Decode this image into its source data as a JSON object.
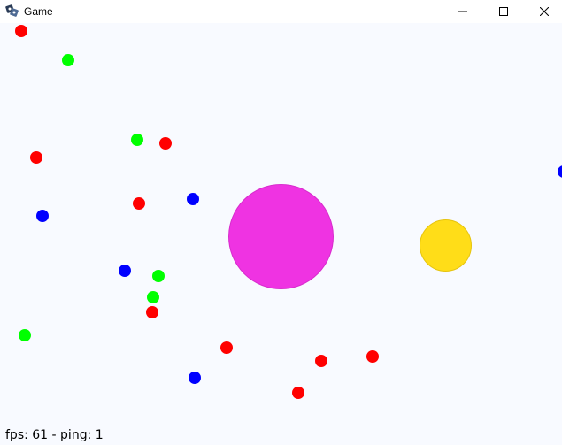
{
  "window": {
    "title": "Game",
    "icon": "game-controller-icon",
    "controls": [
      "minimize-icon",
      "maximize-icon",
      "close-icon"
    ]
  },
  "game": {
    "background_color": "#f8faff",
    "player": {
      "type": "player",
      "color": "#ef33e2",
      "border": "#d82ccd"
    },
    "big_blob": {
      "type": "blob",
      "color": "#ffdd18",
      "border": "#e6c40f"
    },
    "food_colors": {
      "red": "#ff0000",
      "green": "#00ff00",
      "blue": "#0000ff"
    },
    "food": [
      {
        "color": "red"
      },
      {
        "color": "green"
      },
      {
        "color": "green"
      },
      {
        "color": "red"
      },
      {
        "color": "red"
      },
      {
        "color": "blue"
      },
      {
        "color": "red"
      },
      {
        "color": "blue"
      },
      {
        "color": "blue"
      },
      {
        "color": "green"
      },
      {
        "color": "green"
      },
      {
        "color": "red"
      },
      {
        "color": "green"
      },
      {
        "color": "red"
      },
      {
        "color": "red"
      },
      {
        "color": "red"
      },
      {
        "color": "blue"
      },
      {
        "color": "red"
      },
      {
        "color": "blue"
      }
    ]
  },
  "hud": {
    "text": "fps: 61 - ping: 1"
  }
}
